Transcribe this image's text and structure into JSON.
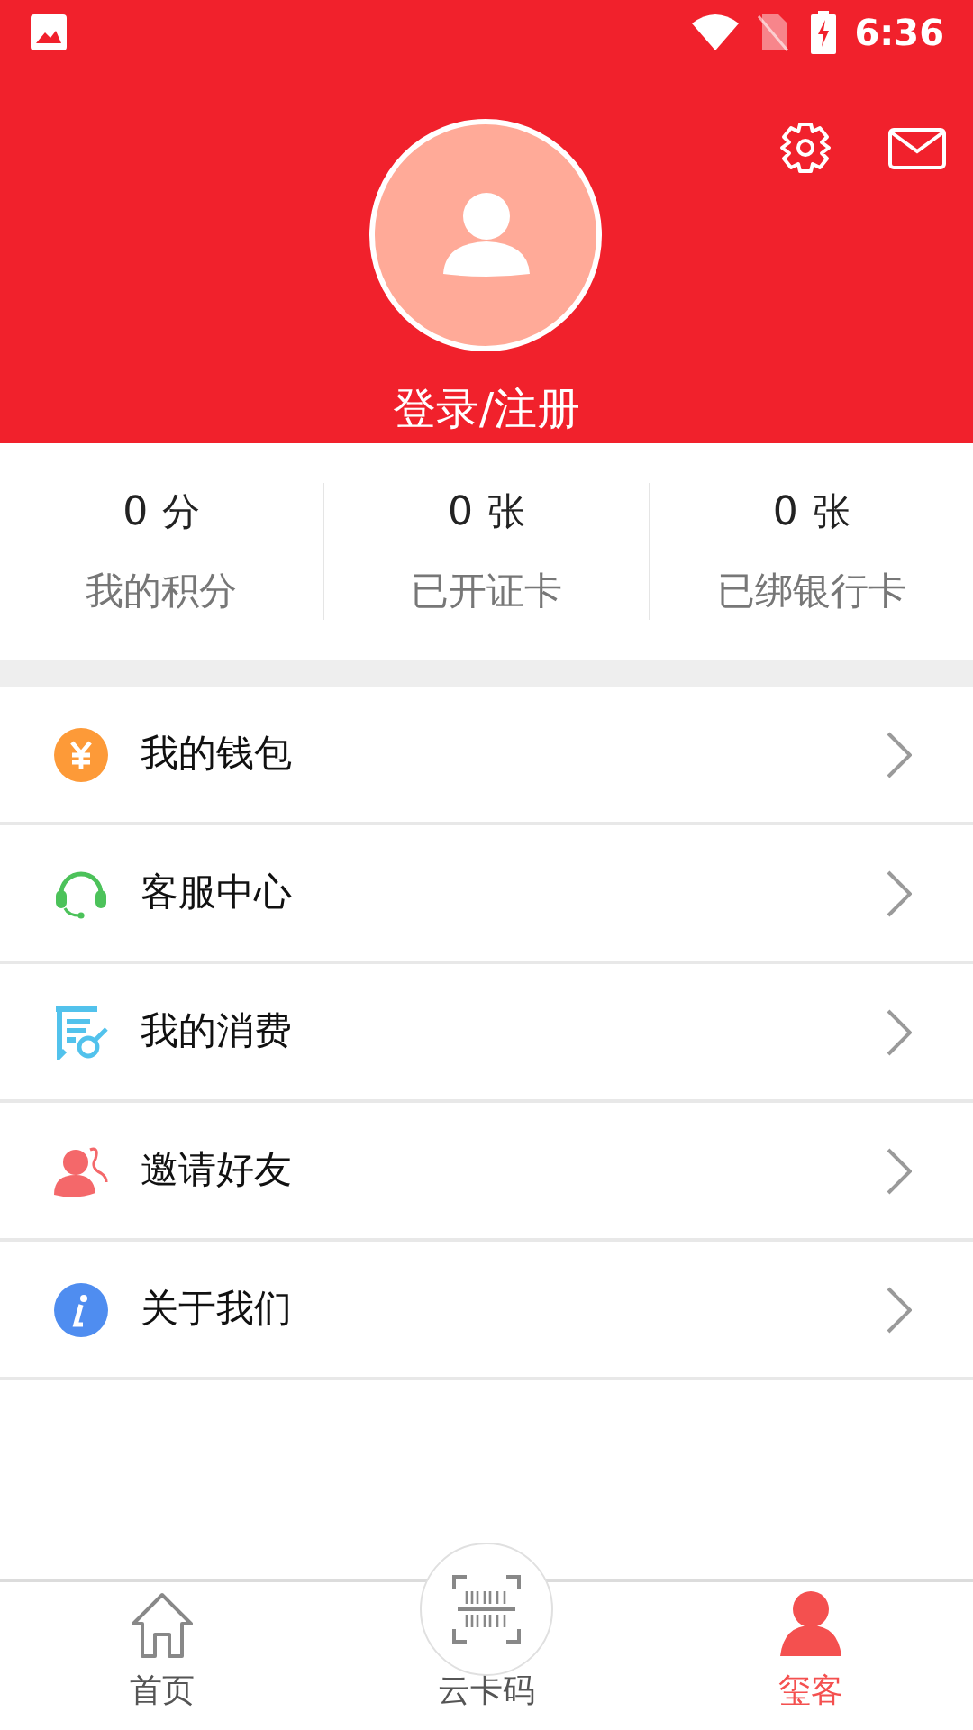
{
  "status_bar": {
    "time": "6:36"
  },
  "profile": {
    "login_label": "登录/注册"
  },
  "stats": [
    {
      "value": "0",
      "unit": "分",
      "label": "我的积分"
    },
    {
      "value": "0",
      "unit": "张",
      "label": "已开证卡"
    },
    {
      "value": "0",
      "unit": "张",
      "label": "已绑银行卡"
    }
  ],
  "menu": [
    {
      "kind": "wallet",
      "label": "我的钱包"
    },
    {
      "kind": "service",
      "label": "客服中心"
    },
    {
      "kind": "consumption",
      "label": "我的消费"
    },
    {
      "kind": "invite",
      "label": "邀请好友"
    },
    {
      "kind": "about",
      "label": "关于我们"
    }
  ],
  "bottom_nav": [
    {
      "kind": "home",
      "label": "首页",
      "selected": false
    },
    {
      "kind": "scan",
      "label": "云卡码",
      "selected": false
    },
    {
      "kind": "profile",
      "label": "玺客",
      "selected": true
    }
  ]
}
